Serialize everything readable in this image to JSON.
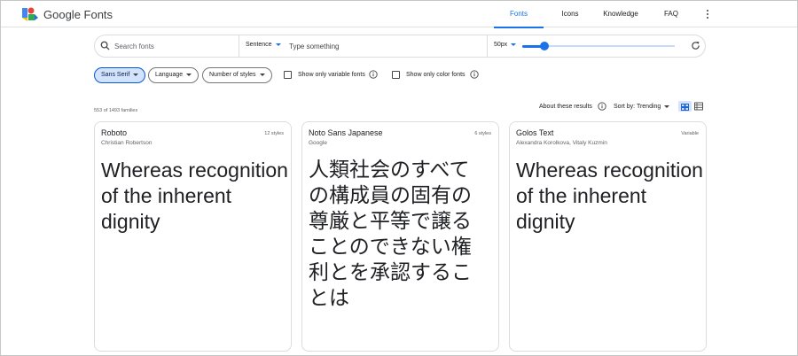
{
  "header": {
    "brand": "Google Fonts",
    "nav": [
      {
        "label": "Fonts",
        "active": true
      },
      {
        "label": "Icons",
        "active": false
      },
      {
        "label": "Knowledge",
        "active": false
      },
      {
        "label": "FAQ",
        "active": false
      }
    ]
  },
  "search": {
    "placeholder": "Search fonts",
    "preview_mode": "Sentence",
    "preview_placeholder": "Type something",
    "font_size": "50px",
    "slider_value_fraction": 0.14
  },
  "filters": {
    "category": "Sans Serif",
    "language": "Language",
    "styles": "Number of styles",
    "variable_label": "Show only variable fonts",
    "color_label": "Show only color fonts"
  },
  "results": {
    "count": "553 of 1493 families",
    "about": "About these results",
    "sort": "Sort by: Trending"
  },
  "cards": [
    {
      "name": "Roboto",
      "author": "Christian Robertson",
      "styles": "12 styles",
      "sample": "Whereas recognition of the inherent dignity"
    },
    {
      "name": "Noto Sans Japanese",
      "author": "Google",
      "styles": "6 styles",
      "sample": "人類社会のすべての構成員の固有の尊厳と平等で譲ることのできない権利とを承認することは"
    },
    {
      "name": "Golos Text",
      "author": "Alexandra Korolkova, Vitaly Kuzmin",
      "styles": "Variable",
      "sample": "Whereas recognition of the inherent dignity"
    }
  ],
  "colors": {
    "accent": "#1a73e8",
    "chip_selected": "#d3e3fd"
  }
}
